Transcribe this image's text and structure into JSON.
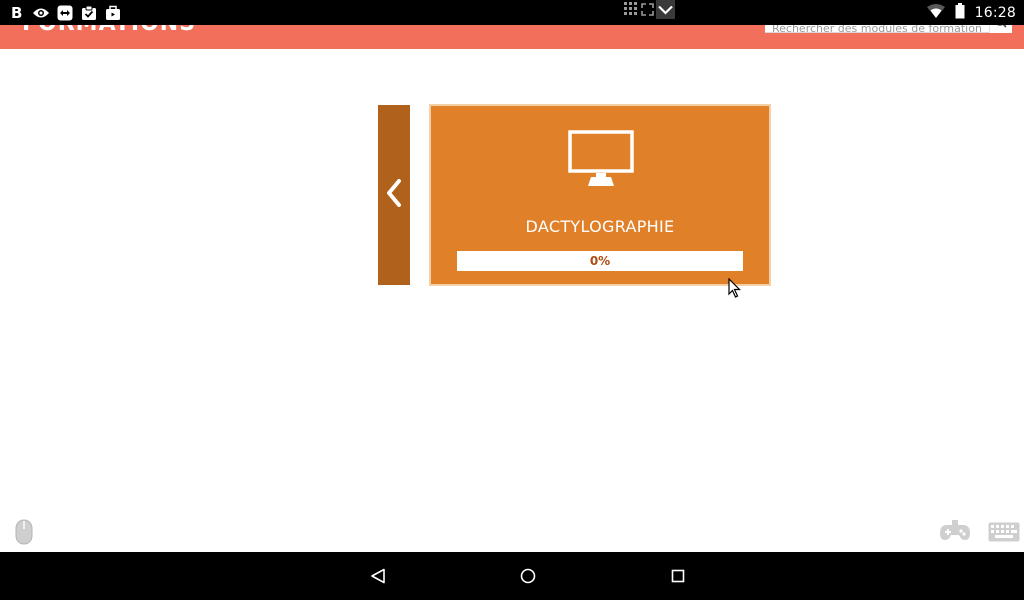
{
  "status_bar": {
    "left_icons": [
      "bold-b-icon",
      "eye-icon",
      "teamviewer-icon",
      "clipboard-check-icon",
      "briefcase-icon"
    ],
    "center_icons": [
      "grid-icon",
      "expand-icon",
      "chevron-down-icon"
    ],
    "right_icons": [
      "wifi-icon",
      "battery-icon"
    ],
    "time": "16:28"
  },
  "header": {
    "title": "FORMATIONS",
    "search": {
      "placeholder": "Rechercher des modules de formation",
      "icon": "search-icon"
    },
    "color": "#f26f5c"
  },
  "carousel": {
    "prev_icon": "chevron-left-icon",
    "card": {
      "icon": "monitor-icon",
      "title": "DACTYLOGRAPHIE",
      "progress_label": "0%",
      "progress_value": 0,
      "color": "#e0812a"
    },
    "nav_color": "#b0611b"
  },
  "overlay_icons": [
    "mouse-icon",
    "gamepad-icon",
    "keyboard-icon"
  ],
  "nav_bar": {
    "buttons": [
      "back-triangle-icon",
      "home-circle-icon",
      "recents-square-icon"
    ]
  }
}
